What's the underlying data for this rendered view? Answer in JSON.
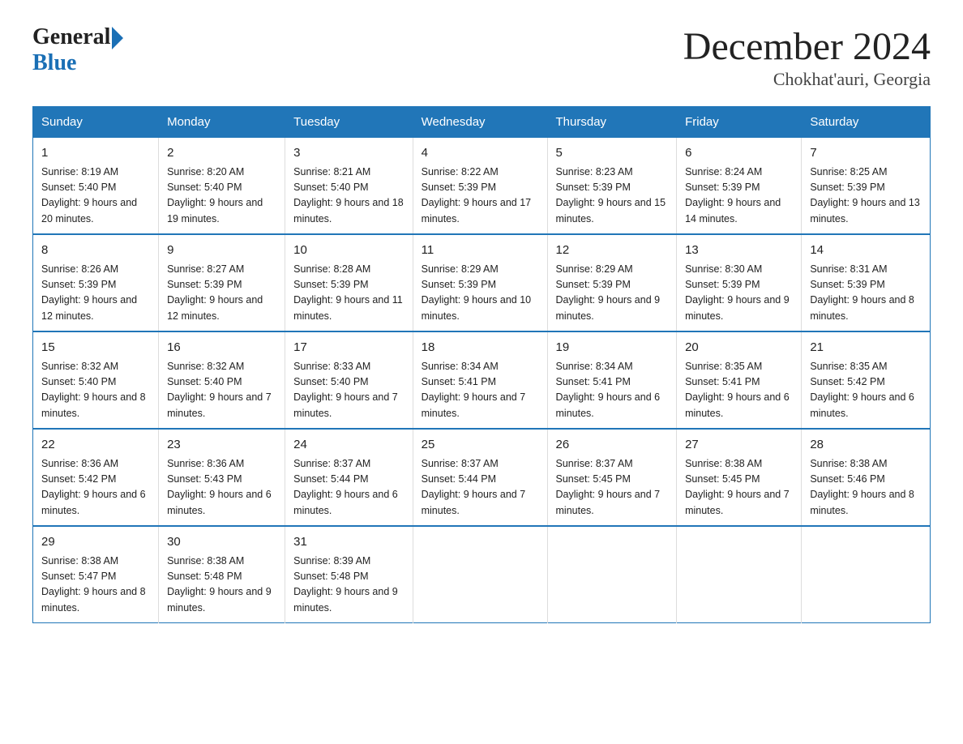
{
  "header": {
    "title": "December 2024",
    "subtitle": "Chokhat'auri, Georgia"
  },
  "logo": {
    "general": "General",
    "blue": "Blue"
  },
  "days_of_week": [
    "Sunday",
    "Monday",
    "Tuesday",
    "Wednesday",
    "Thursday",
    "Friday",
    "Saturday"
  ],
  "weeks": [
    [
      {
        "day": "1",
        "sunrise": "8:19 AM",
        "sunset": "5:40 PM",
        "daylight": "9 hours and 20 minutes."
      },
      {
        "day": "2",
        "sunrise": "8:20 AM",
        "sunset": "5:40 PM",
        "daylight": "9 hours and 19 minutes."
      },
      {
        "day": "3",
        "sunrise": "8:21 AM",
        "sunset": "5:40 PM",
        "daylight": "9 hours and 18 minutes."
      },
      {
        "day": "4",
        "sunrise": "8:22 AM",
        "sunset": "5:39 PM",
        "daylight": "9 hours and 17 minutes."
      },
      {
        "day": "5",
        "sunrise": "8:23 AM",
        "sunset": "5:39 PM",
        "daylight": "9 hours and 15 minutes."
      },
      {
        "day": "6",
        "sunrise": "8:24 AM",
        "sunset": "5:39 PM",
        "daylight": "9 hours and 14 minutes."
      },
      {
        "day": "7",
        "sunrise": "8:25 AM",
        "sunset": "5:39 PM",
        "daylight": "9 hours and 13 minutes."
      }
    ],
    [
      {
        "day": "8",
        "sunrise": "8:26 AM",
        "sunset": "5:39 PM",
        "daylight": "9 hours and 12 minutes."
      },
      {
        "day": "9",
        "sunrise": "8:27 AM",
        "sunset": "5:39 PM",
        "daylight": "9 hours and 12 minutes."
      },
      {
        "day": "10",
        "sunrise": "8:28 AM",
        "sunset": "5:39 PM",
        "daylight": "9 hours and 11 minutes."
      },
      {
        "day": "11",
        "sunrise": "8:29 AM",
        "sunset": "5:39 PM",
        "daylight": "9 hours and 10 minutes."
      },
      {
        "day": "12",
        "sunrise": "8:29 AM",
        "sunset": "5:39 PM",
        "daylight": "9 hours and 9 minutes."
      },
      {
        "day": "13",
        "sunrise": "8:30 AM",
        "sunset": "5:39 PM",
        "daylight": "9 hours and 9 minutes."
      },
      {
        "day": "14",
        "sunrise": "8:31 AM",
        "sunset": "5:39 PM",
        "daylight": "9 hours and 8 minutes."
      }
    ],
    [
      {
        "day": "15",
        "sunrise": "8:32 AM",
        "sunset": "5:40 PM",
        "daylight": "9 hours and 8 minutes."
      },
      {
        "day": "16",
        "sunrise": "8:32 AM",
        "sunset": "5:40 PM",
        "daylight": "9 hours and 7 minutes."
      },
      {
        "day": "17",
        "sunrise": "8:33 AM",
        "sunset": "5:40 PM",
        "daylight": "9 hours and 7 minutes."
      },
      {
        "day": "18",
        "sunrise": "8:34 AM",
        "sunset": "5:41 PM",
        "daylight": "9 hours and 7 minutes."
      },
      {
        "day": "19",
        "sunrise": "8:34 AM",
        "sunset": "5:41 PM",
        "daylight": "9 hours and 6 minutes."
      },
      {
        "day": "20",
        "sunrise": "8:35 AM",
        "sunset": "5:41 PM",
        "daylight": "9 hours and 6 minutes."
      },
      {
        "day": "21",
        "sunrise": "8:35 AM",
        "sunset": "5:42 PM",
        "daylight": "9 hours and 6 minutes."
      }
    ],
    [
      {
        "day": "22",
        "sunrise": "8:36 AM",
        "sunset": "5:42 PM",
        "daylight": "9 hours and 6 minutes."
      },
      {
        "day": "23",
        "sunrise": "8:36 AM",
        "sunset": "5:43 PM",
        "daylight": "9 hours and 6 minutes."
      },
      {
        "day": "24",
        "sunrise": "8:37 AM",
        "sunset": "5:44 PM",
        "daylight": "9 hours and 6 minutes."
      },
      {
        "day": "25",
        "sunrise": "8:37 AM",
        "sunset": "5:44 PM",
        "daylight": "9 hours and 7 minutes."
      },
      {
        "day": "26",
        "sunrise": "8:37 AM",
        "sunset": "5:45 PM",
        "daylight": "9 hours and 7 minutes."
      },
      {
        "day": "27",
        "sunrise": "8:38 AM",
        "sunset": "5:45 PM",
        "daylight": "9 hours and 7 minutes."
      },
      {
        "day": "28",
        "sunrise": "8:38 AM",
        "sunset": "5:46 PM",
        "daylight": "9 hours and 8 minutes."
      }
    ],
    [
      {
        "day": "29",
        "sunrise": "8:38 AM",
        "sunset": "5:47 PM",
        "daylight": "9 hours and 8 minutes."
      },
      {
        "day": "30",
        "sunrise": "8:38 AM",
        "sunset": "5:48 PM",
        "daylight": "9 hours and 9 minutes."
      },
      {
        "day": "31",
        "sunrise": "8:39 AM",
        "sunset": "5:48 PM",
        "daylight": "9 hours and 9 minutes."
      },
      null,
      null,
      null,
      null
    ]
  ]
}
